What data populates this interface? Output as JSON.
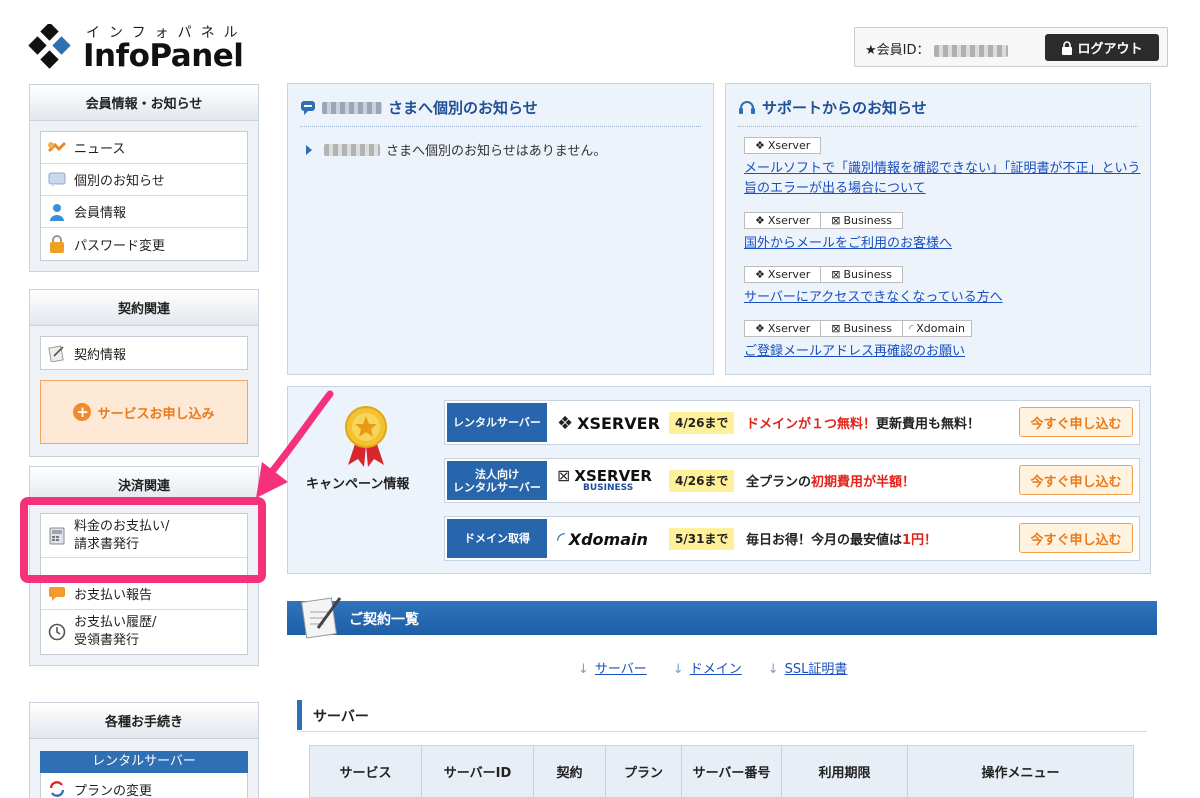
{
  "header": {
    "logo_kana": "インフォパネル",
    "logo_name": "InfoPanel",
    "member_id_label": "★会員ID：",
    "logout_label": "ログアウト"
  },
  "sidebar": {
    "member_section": {
      "title": "会員情報・お知らせ",
      "items": [
        {
          "label": "ニュース",
          "icon": "news-icon"
        },
        {
          "label": "個別のお知らせ",
          "icon": "message-icon"
        },
        {
          "label": "会員情報",
          "icon": "user-icon"
        },
        {
          "label": "パスワード変更",
          "icon": "lock-icon"
        }
      ]
    },
    "contract_section": {
      "title": "契約関連",
      "items": [
        {
          "label": "契約情報",
          "icon": "contract-icon"
        }
      ],
      "apply_label": "サービスお申し込み"
    },
    "payment_section": {
      "title": "決済関連",
      "items": [
        {
          "label_line1": "料金のお支払い/",
          "label_line2": "請求書発行",
          "icon": "calculator-icon"
        },
        {
          "label": "お支払い報告",
          "icon": "chat-icon"
        },
        {
          "label_line1": "お支払い履歴/",
          "label_line2": "受領書発行",
          "icon": "clock-icon"
        }
      ]
    },
    "procedures_section": {
      "title": "各種お手続き",
      "sub_title": "レンタルサーバー",
      "items": [
        {
          "label": "プランの変更",
          "icon": "change-icon"
        }
      ]
    }
  },
  "individual_notice": {
    "title_suffix": "さまへ個別のお知らせ",
    "message_suffix": "さまへ個別のお知らせはありません。"
  },
  "support_notice": {
    "title": "サポートからのお知らせ",
    "items": [
      {
        "tags": [
          "Xserver"
        ],
        "link": "メールソフトで「識別情報を確認できない」「証明書が不正」という旨のエラーが出る場合について"
      },
      {
        "tags": [
          "Xserver",
          "Business"
        ],
        "link": "国外からメールをご利用のお客様へ"
      },
      {
        "tags": [
          "Xserver",
          "Business"
        ],
        "link": "サーバーにアクセスできなくなっている方へ"
      },
      {
        "tags": [
          "Xserver",
          "Business",
          "Xdomain"
        ],
        "link": "ご登録メールアドレス再確認のお願い"
      }
    ]
  },
  "campaign": {
    "label": "キャンペーン情報",
    "rows": [
      {
        "category": "レンタルサーバー",
        "logo": "XSERVER",
        "date": "4/26まで",
        "text_red": "ドメインが１つ無料！",
        "text_rest": "更新費用も無料！",
        "button": "今すぐ申し込む"
      },
      {
        "category_line1": "法人向け",
        "category_line2": "レンタルサーバー",
        "logo": "XSERVER",
        "logo_sub": "BUSINESS",
        "date": "4/26まで",
        "text_pre": "全プランの",
        "text_red": "初期費用が半額！",
        "button": "今すぐ申し込む"
      },
      {
        "category": "ドメイン取得",
        "logo": "Xdomain",
        "date": "5/31まで",
        "text_pre": "毎日お得！今月の最安値は",
        "text_red": "1円！",
        "button": "今すぐ申し込む"
      }
    ]
  },
  "contracts": {
    "title": "ご契約一覧",
    "links": [
      "サーバー",
      "ドメイン",
      "SSL証明書"
    ],
    "server_section": "サーバー",
    "table_headers": [
      "サービス",
      "サーバーID",
      "契約",
      "プラン",
      "サーバー番号",
      "利用期限",
      "操作メニュー"
    ]
  },
  "colors": {
    "accent_blue": "#2f6fb3",
    "highlight_pink": "#f4317a",
    "orange": "#e87a1b",
    "red": "#e2231a"
  }
}
